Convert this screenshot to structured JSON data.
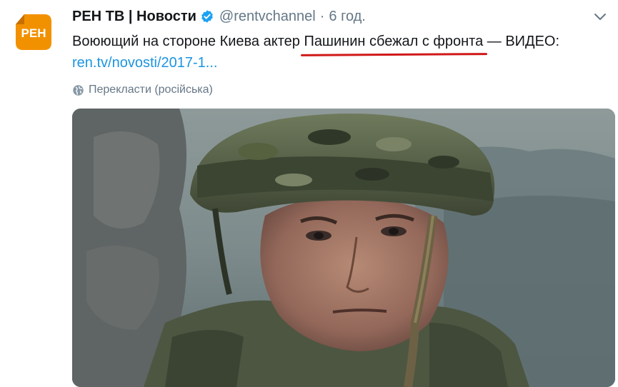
{
  "author": {
    "name": "РЕН ТВ | Новости",
    "handle": "@rentvchannel",
    "separator": "·",
    "time": "6 год.",
    "avatar_text": "РЕН"
  },
  "tweet": {
    "text_before": "Воюющий на стороне Киева актер ",
    "text_underlined": "Пашинин сбежал с фронта",
    "text_after": " — ВИДЕО:",
    "link": "ren.tv/novosti/2017-1..."
  },
  "translate_label": "Перекласти (російська)",
  "icons": [
    "verified-badge-icon",
    "chevron-down-icon",
    "globe-icon"
  ],
  "colors": {
    "link": "#1b95e0",
    "verified": "#1da1f2",
    "underline": "#d01818",
    "brand": "#f29100"
  }
}
